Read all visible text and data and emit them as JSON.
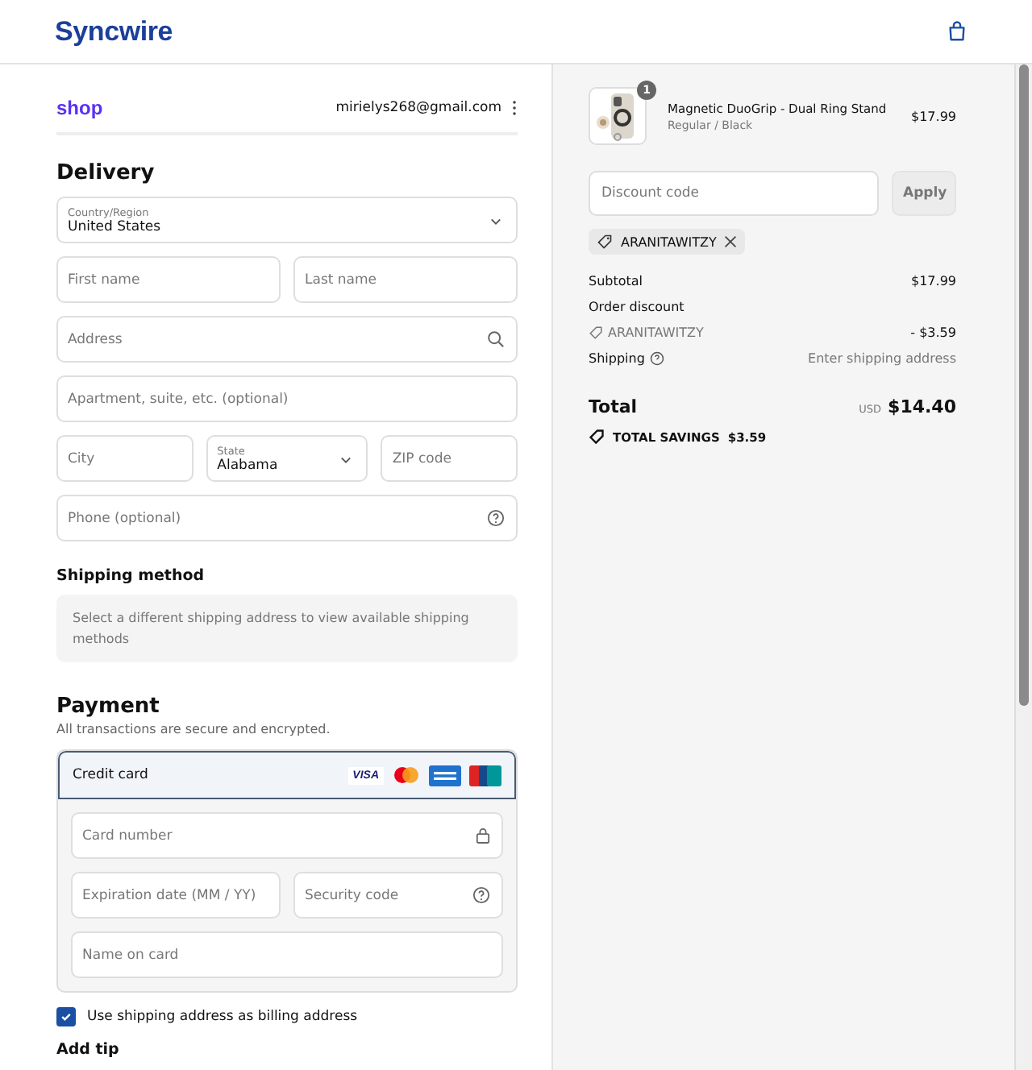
{
  "header": {
    "logo": "Syncwire"
  },
  "account": {
    "brand": "shop",
    "email": "mirielys268@gmail.com"
  },
  "delivery": {
    "title": "Delivery",
    "fields": [
      {
        "kind": "select",
        "label": "Country/Region",
        "value": "United States"
      },
      {
        "kind": "row",
        "items": [
          {
            "kind": "text",
            "placeholder": "First name"
          },
          {
            "kind": "text",
            "placeholder": "Last name"
          }
        ]
      },
      {
        "kind": "search",
        "placeholder": "Address"
      },
      {
        "kind": "text",
        "placeholder": "Apartment, suite, etc. (optional)"
      },
      {
        "kind": "row",
        "items": [
          {
            "kind": "text",
            "placeholder": "City"
          },
          {
            "kind": "select",
            "label": "State",
            "value": "Alabama"
          },
          {
            "kind": "text",
            "placeholder": "ZIP code"
          }
        ]
      },
      {
        "kind": "help",
        "placeholder": "Phone (optional)"
      }
    ]
  },
  "shipping_method": {
    "title": "Shipping method",
    "notice": "Select a different shipping address to view available shipping methods"
  },
  "payment": {
    "title": "Payment",
    "subtitle": "All transactions are secure and encrypted.",
    "method": {
      "label": "Credit card",
      "selected": true,
      "visa": "VISA"
    },
    "fields": [
      {
        "kind": "lock",
        "placeholder": "Card number"
      },
      {
        "kind": "row",
        "items": [
          {
            "kind": "text",
            "placeholder": "Expiration date (MM / YY)"
          },
          {
            "kind": "help",
            "placeholder": "Security code"
          }
        ]
      },
      {
        "kind": "text",
        "placeholder": "Name on card"
      }
    ],
    "billing": {
      "label": "Use shipping address as billing address",
      "checked": true
    }
  },
  "tip": {
    "title": "Add tip"
  },
  "summary": {
    "item": {
      "quantity": "1",
      "name": "Magnetic DuoGrip - Dual Ring Stand",
      "variant": "Regular / Black",
      "price": "$17.99"
    },
    "discount": {
      "placeholder": "Discount code",
      "button": "Apply",
      "code": "ARANITAWITZY"
    },
    "subtotal": {
      "label": "Subtotal",
      "value": "$17.99"
    },
    "order_discount": {
      "label": "Order discount",
      "code": "ARANITAWITZY",
      "value": "- $3.59"
    },
    "shipping": {
      "label": "Shipping",
      "value": "Enter shipping address"
    },
    "total": {
      "label": "Total",
      "currency": "USD",
      "value": "$14.40"
    },
    "savings": {
      "label": "TOTAL SAVINGS",
      "value": "$3.59"
    }
  }
}
